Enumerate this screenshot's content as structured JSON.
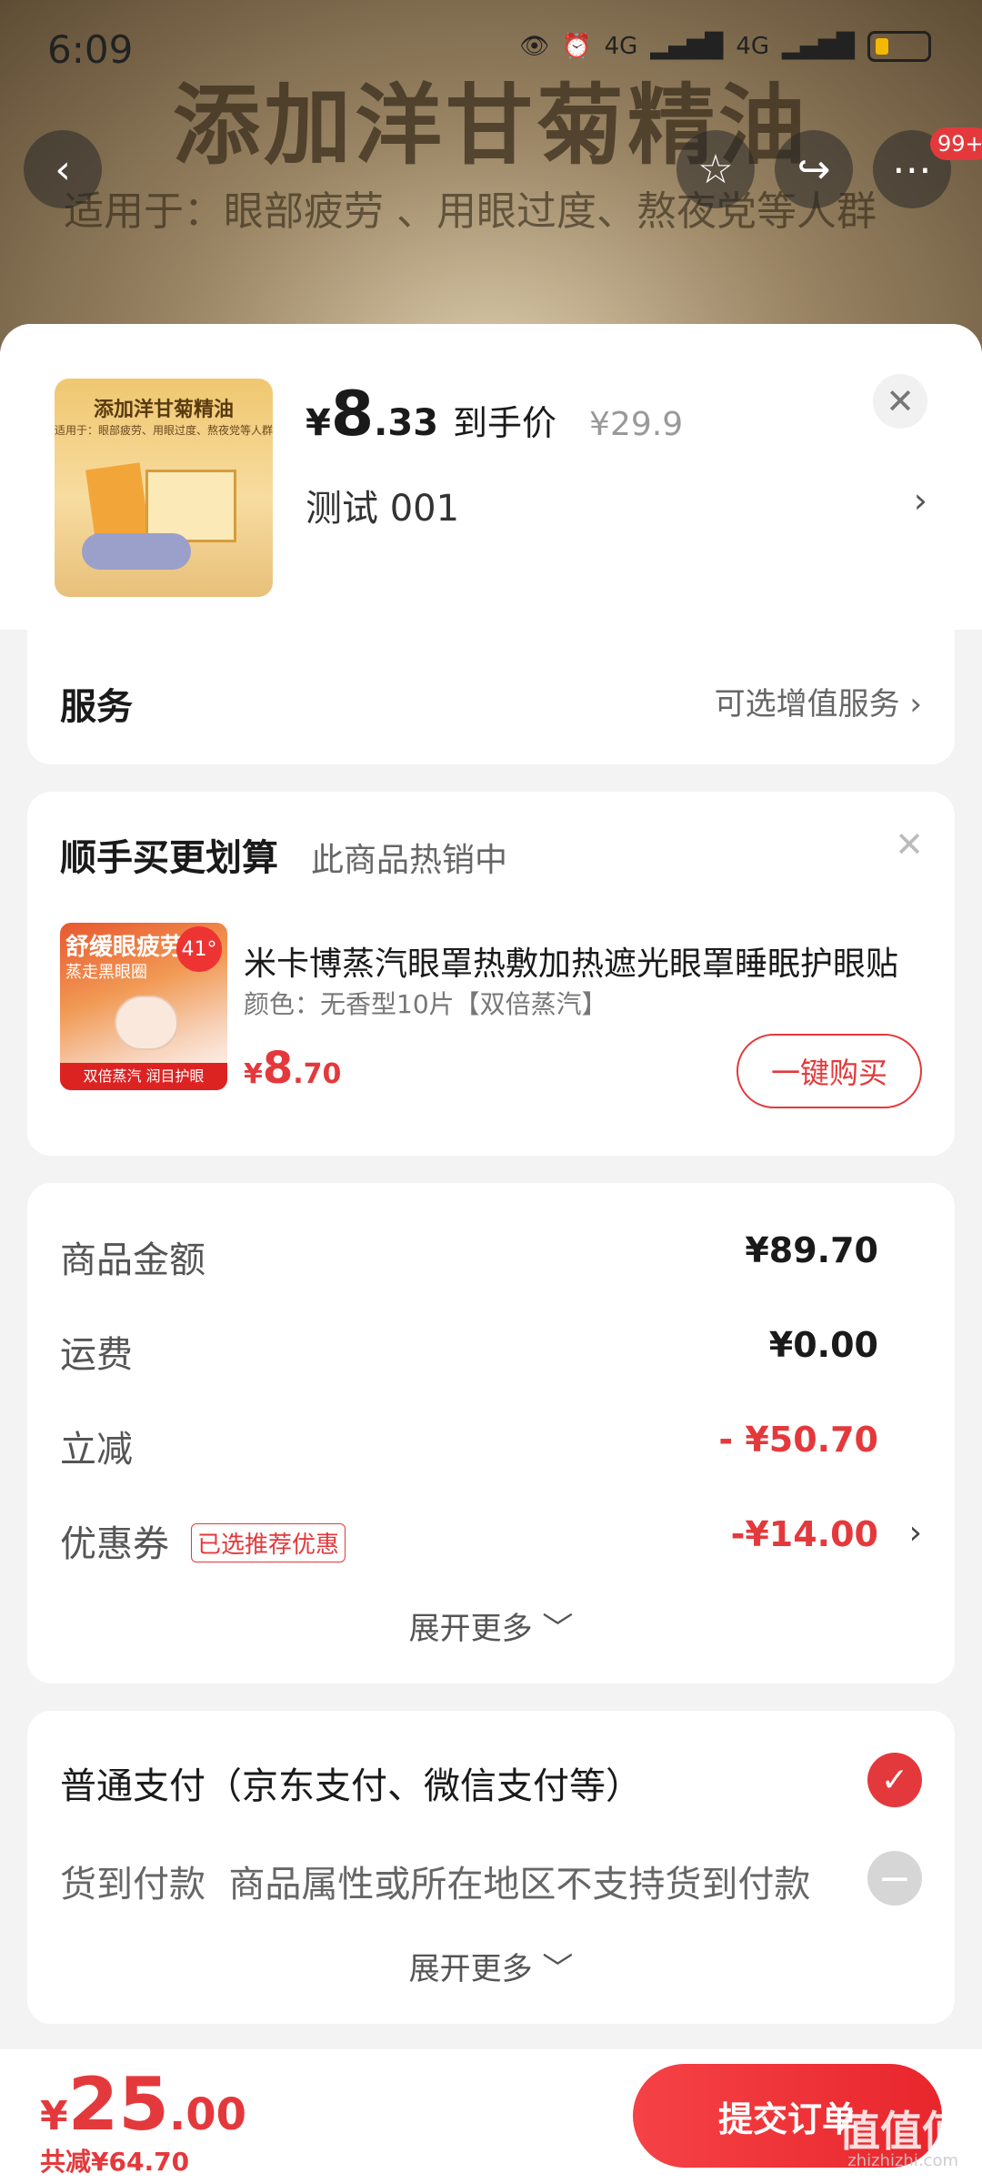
{
  "status_bar": {
    "time": "6:09",
    "network1": "4G",
    "network2": "4G"
  },
  "background": {
    "title": "添加洋甘菊精油",
    "subtitle": "适用于：眼部疲劳 、用眼过度、熬夜党等人群"
  },
  "top_actions": {
    "badge": "99+"
  },
  "product": {
    "image_title": "添加洋甘菊精油",
    "image_subtitle": "适用于：眼部疲劳、用眼过度、熬夜党等人群",
    "price_symbol": "¥",
    "price_int": "8",
    "price_dec": ".33",
    "price_label": "到手价",
    "original_price": "¥29.9",
    "spec": "测试  001"
  },
  "service": {
    "title": "服务",
    "hint": "可选增值服务"
  },
  "bundle": {
    "title": "顺手买更划算",
    "hot": "此商品热销中",
    "image_title": "舒缓眼疲劳",
    "image_sub": "蒸走黑眼圈",
    "image_temp": "41°",
    "image_bar": "双倍蒸汽 润目护眼",
    "item_name": "米卡博蒸汽眼罩热敷加热遮光眼罩睡眠护眼贴",
    "item_spec": "颜色：无香型10片【双倍蒸汽】",
    "price_symbol": "¥",
    "price_int": "8",
    "price_dec": ".70",
    "button": "一键购买"
  },
  "summary": {
    "rows": [
      {
        "label": "商品金额",
        "value": "¥89.70"
      },
      {
        "label": "运费",
        "value": "¥0.00"
      },
      {
        "label": "立减",
        "value": "- ¥50.70"
      },
      {
        "label": "优惠券",
        "value": "-¥14.00",
        "tag": "已选推荐优惠"
      }
    ],
    "more": "展开更多 ﹀"
  },
  "payment": {
    "normal": "普通支付（京东支付、微信支付等）",
    "cod_label": "货到付款",
    "cod_note": "商品属性或所在地区不支持货到付款",
    "more": "展开更多 ﹀"
  },
  "bottom": {
    "total_symbol": "¥",
    "total_int": "25",
    "total_dec": ".00",
    "saved": "共减¥64.70",
    "submit": "提交订单",
    "watermark": "值值值",
    "watermark_url": "zhizhizhi.com"
  },
  "colors": {
    "accent": "#e4393c"
  },
  "icons": [
    "back-icon",
    "star-icon",
    "share-icon",
    "more-icon",
    "close-icon",
    "chevron-right-icon",
    "check-icon",
    "disabled-icon"
  ]
}
